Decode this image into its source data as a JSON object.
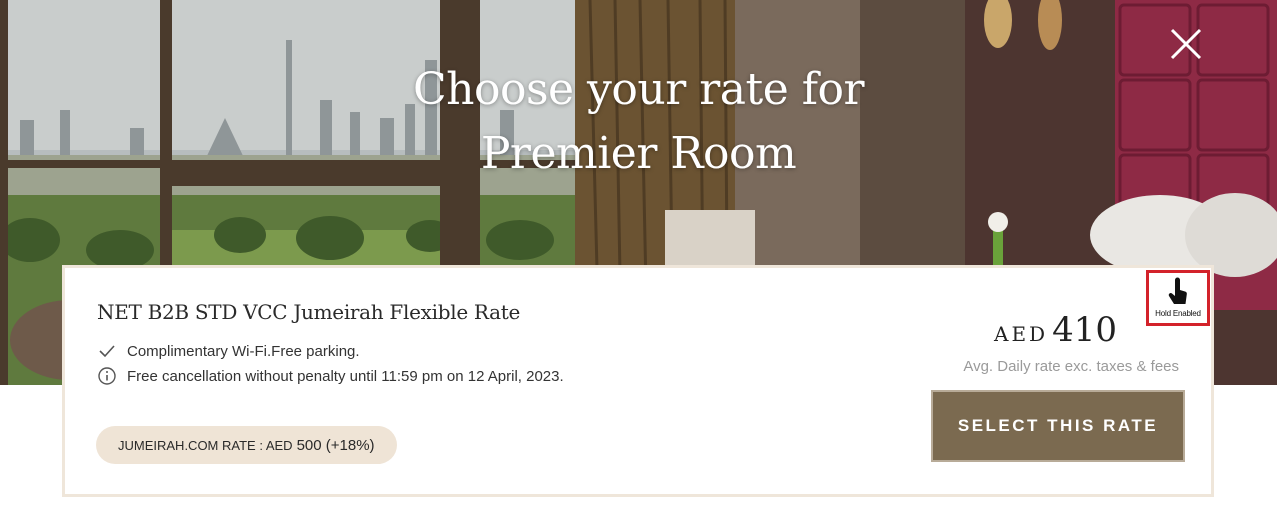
{
  "hero": {
    "title_line1": "Choose your rate for",
    "title_line2": "Premier Room"
  },
  "close_icon": "close-icon",
  "rate_card": {
    "name": "NET B2B STD VCC Jumeirah Flexible Rate",
    "features": [
      {
        "icon": "check-icon",
        "text": "Complimentary Wi-Fi.Free parking."
      },
      {
        "icon": "info-icon",
        "text": "Free cancellation without penalty until 11:59 pm on 12 April, 2023."
      }
    ],
    "hold": {
      "icon": "tap-hand-icon",
      "label": "Hold Enabled"
    },
    "price": {
      "currency": "AED",
      "amount": "410",
      "note": "Avg. Daily rate exc. taxes & fees"
    },
    "select_label": "SELECT THIS RATE",
    "comparison": {
      "label": "JUMEIRAH.COM RATE : AED",
      "amount": "500 (+18%)"
    }
  },
  "colors": {
    "card_border": "#efe6da",
    "pill_bg": "#efe4d6",
    "button_bg": "#7b6a50",
    "hold_border": "#d3222a"
  }
}
